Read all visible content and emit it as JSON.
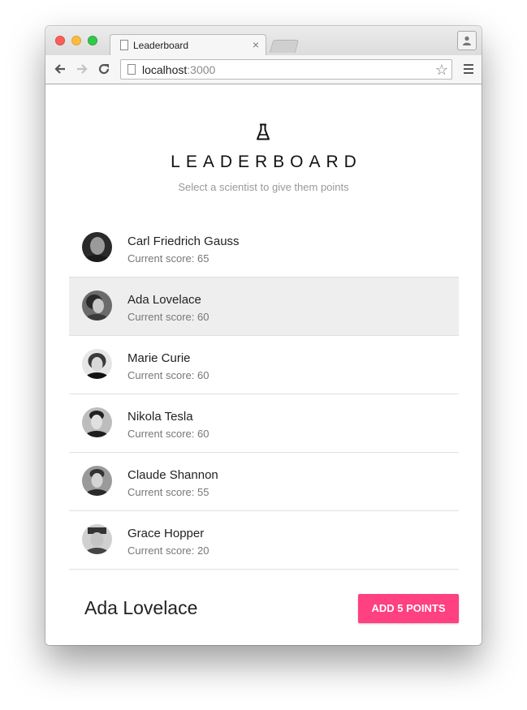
{
  "browser": {
    "tab_title": "Leaderboard",
    "tab_close": "×",
    "url_host": "localhost",
    "url_port": ":3000"
  },
  "app": {
    "title": "LEADERBOARD",
    "subtitle": "Select a scientist to give them points",
    "icon": "flask-icon"
  },
  "players": [
    {
      "name": "Carl Friedrich Gauss",
      "score_text": "Current score: 65",
      "score": 65,
      "selected": false
    },
    {
      "name": "Ada Lovelace",
      "score_text": "Current score: 60",
      "score": 60,
      "selected": true
    },
    {
      "name": "Marie Curie",
      "score_text": "Current score: 60",
      "score": 60,
      "selected": false
    },
    {
      "name": "Nikola Tesla",
      "score_text": "Current score: 60",
      "score": 60,
      "selected": false
    },
    {
      "name": "Claude Shannon",
      "score_text": "Current score: 55",
      "score": 55,
      "selected": false
    },
    {
      "name": "Grace Hopper",
      "score_text": "Current score: 20",
      "score": 20,
      "selected": false
    }
  ],
  "details": {
    "selected_name": "Ada Lovelace",
    "button_label": "ADD 5 POINTS"
  },
  "colors": {
    "accent": "#ff4081",
    "selected_row": "#eeeeee"
  }
}
